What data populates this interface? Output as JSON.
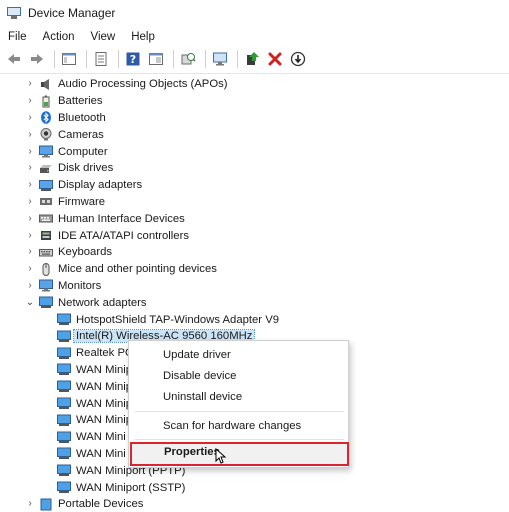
{
  "window": {
    "title": "Device Manager"
  },
  "menu": [
    "File",
    "Action",
    "View",
    "Help"
  ],
  "toolbar": [
    {
      "icon": "back-arrow-icon"
    },
    {
      "icon": "forward-arrow-icon"
    },
    {
      "icon": "show-hide-console-tree-icon"
    },
    {
      "icon": "properties-sheet-icon"
    },
    {
      "icon": "help-icon"
    },
    {
      "icon": "show-panel-icon"
    },
    {
      "icon": "scan-hardware-icon"
    },
    {
      "icon": "monitor-icon"
    },
    {
      "icon": "update-driver-icon"
    },
    {
      "icon": "uninstall-red-x-icon"
    },
    {
      "icon": "disable-device-icon"
    }
  ],
  "tree": {
    "categories": [
      {
        "label": "Audio Processing Objects (APOs)",
        "icon": "speaker-icon"
      },
      {
        "label": "Batteries",
        "icon": "battery-icon"
      },
      {
        "label": "Bluetooth",
        "icon": "bluetooth-icon"
      },
      {
        "label": "Cameras",
        "icon": "camera-icon"
      },
      {
        "label": "Computer",
        "icon": "computer-icon"
      },
      {
        "label": "Disk drives",
        "icon": "disk-drive-icon"
      },
      {
        "label": "Display adapters",
        "icon": "display-adapter-icon"
      },
      {
        "label": "Firmware",
        "icon": "firmware-icon"
      },
      {
        "label": "Human Interface Devices",
        "icon": "hid-icon"
      },
      {
        "label": "IDE ATA/ATAPI controllers",
        "icon": "ide-controller-icon"
      },
      {
        "label": "Keyboards",
        "icon": "keyboard-icon"
      },
      {
        "label": "Mice and other pointing devices",
        "icon": "mouse-icon"
      },
      {
        "label": "Monitors",
        "icon": "monitor-icon"
      },
      {
        "label": "Network adapters",
        "icon": "network-adapter-icon"
      }
    ],
    "network_children": [
      "HotspotShield TAP-Windows Adapter V9",
      "Intel(R) Wireless-AC 9560 160MHz",
      "Realtek PCI",
      "WAN Minip",
      "WAN Minip",
      "WAN Minip",
      "WAN Minip",
      "WAN Mini",
      "WAN Mini",
      "WAN Miniport (PPTP)",
      "WAN Miniport (SSTP)"
    ],
    "after": {
      "label": "Portable Devices",
      "icon": "portable-device-icon"
    }
  },
  "context_menu": {
    "items": [
      "Update driver",
      "Disable device",
      "Uninstall device",
      "Scan for hardware changes",
      "Properties"
    ],
    "highlighted": "Properties"
  }
}
